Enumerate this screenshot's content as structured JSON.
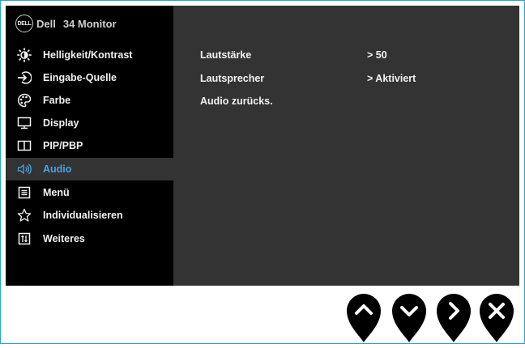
{
  "header": {
    "logo_text": "DELL",
    "brand": "Dell",
    "model": "34 Monitor"
  },
  "menu": {
    "items": [
      {
        "label": "Helligkeit/Kontrast",
        "icon": "brightness-icon",
        "active": false
      },
      {
        "label": "Eingabe-Quelle",
        "icon": "input-source-icon",
        "active": false
      },
      {
        "label": "Farbe",
        "icon": "color-palette-icon",
        "active": false
      },
      {
        "label": "Display",
        "icon": "display-icon",
        "active": false
      },
      {
        "label": "PIP/PBP",
        "icon": "pip-pbp-icon",
        "active": false
      },
      {
        "label": "Audio",
        "icon": "speaker-icon",
        "active": true
      },
      {
        "label": "Menü",
        "icon": "menu-icon",
        "active": false
      },
      {
        "label": "Individualisieren",
        "icon": "star-icon",
        "active": false
      },
      {
        "label": "Weiteres",
        "icon": "others-icon",
        "active": false
      }
    ]
  },
  "audio": {
    "rows": [
      {
        "label": "Lautstärke",
        "value": "> 50"
      },
      {
        "label": "Lautsprecher",
        "value": "> Aktiviert"
      },
      {
        "label": "Audio zurücks.",
        "value": ""
      }
    ]
  },
  "buttons": [
    {
      "name": "up-button",
      "icon": "chevron-up-icon"
    },
    {
      "name": "down-button",
      "icon": "chevron-down-icon"
    },
    {
      "name": "next-button",
      "icon": "chevron-right-icon"
    },
    {
      "name": "exit-button",
      "icon": "close-icon"
    }
  ],
  "colors": {
    "sidebar_bg": "#000000",
    "panel_bg": "#333333",
    "active_text": "#4aa3df",
    "text": "#f2f2f2",
    "frame_border": "#2aa6c9"
  }
}
